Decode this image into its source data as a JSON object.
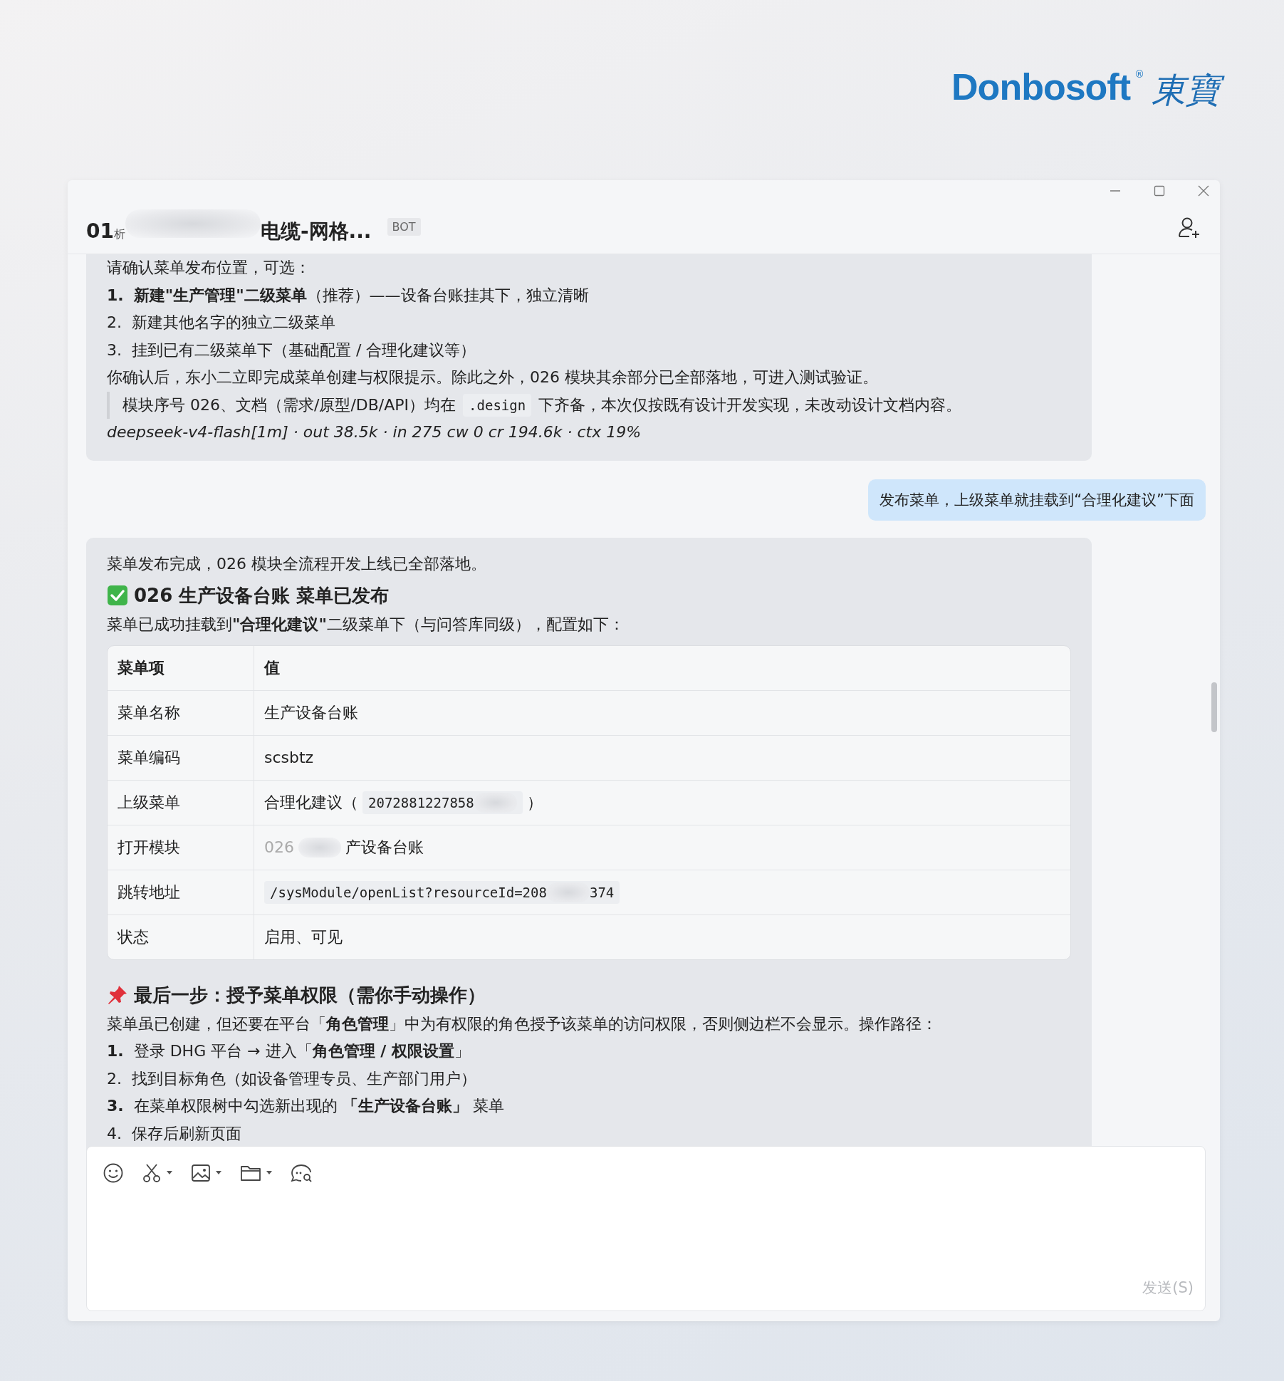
{
  "logo": {
    "text": "Donbosoft",
    "registered": "®",
    "chinese": "東寶"
  },
  "window": {
    "title": [
      {
        "kind": "text",
        "text": "01"
      },
      {
        "kind": "small",
        "text": "析"
      },
      {
        "kind": "blur"
      },
      {
        "kind": "text",
        "text": "电缆-网格..."
      }
    ],
    "badge": "BOT"
  },
  "messages": [
    {
      "kind": "bot",
      "blocks": [
        {
          "kind": "p",
          "text": "请确认菜单发布位置，可选："
        },
        {
          "kind": "li",
          "number": "1.",
          "number_bold": true,
          "text": "**新建\"生产管理\"二级菜单**（推荐）——设备台账挂其下，独立清晰"
        },
        {
          "kind": "li",
          "number": "2.",
          "number_bold": false,
          "text": "新建其他名字的独立二级菜单"
        },
        {
          "kind": "li",
          "number": "3.",
          "number_bold": false,
          "text": "挂到已有二级菜单下（基础配置 / 合理化建议等）"
        },
        {
          "kind": "p",
          "text": "你确认后，东小二立即完成菜单创建与权限提示。除此之外，026 模块其余部分已全部落地，可进入测试验证。"
        },
        {
          "kind": "quote",
          "parts": [
            {
              "kind": "text",
              "text": "模块序号 026、文档（需求/原型/DB/API）均在"
            },
            {
              "kind": "code",
              "text": ".design"
            },
            {
              "kind": "text",
              "text": "下齐备，本次仅按既有设计开发实现，未改动设计文档内容。"
            }
          ]
        },
        {
          "kind": "meta",
          "text": "deepseek-v4-flash[1m] · out 38.5k · in 275 cw 0 cr 194.6k · ctx 19%"
        }
      ]
    },
    {
      "kind": "user",
      "text": "发布菜单，上级菜单就挂载到“合理化建议”下面"
    },
    {
      "kind": "bot",
      "blocks": [
        {
          "kind": "p",
          "text": "菜单发布完成，026 模块全流程开发上线已全部落地。"
        },
        {
          "kind": "checkheading",
          "text": "026 生产设备台账 菜单已发布"
        },
        {
          "kind": "p",
          "text": "菜单已成功挂载到**\"合理化建议\"**二级菜单下（与问答库同级），配置如下："
        },
        {
          "kind": "table",
          "columns": [
            "菜单项",
            "值"
          ],
          "rows": [
            {
              "label": "菜单名称",
              "value": [
                {
                  "kind": "text",
                  "text": "生产设备台账"
                }
              ]
            },
            {
              "label": "菜单编码",
              "value": [
                {
                  "kind": "text",
                  "text": "scsbtz"
                }
              ]
            },
            {
              "label": "上级菜单",
              "value": [
                {
                  "kind": "text",
                  "text": "合理化建议（"
                },
                {
                  "kind": "code",
                  "parts": [
                    {
                      "kind": "text",
                      "text": "2072881227858"
                    },
                    {
                      "kind": "blur"
                    }
                  ]
                },
                {
                  "kind": "text",
                  "text": "）"
                }
              ]
            },
            {
              "label": "打开模块",
              "value": [
                {
                  "kind": "faint",
                  "text": "026"
                },
                {
                  "kind": "blur"
                },
                {
                  "kind": "text",
                  "text": "产设备台账"
                }
              ]
            },
            {
              "label": "跳转地址",
              "value": [
                {
                  "kind": "code",
                  "parts": [
                    {
                      "kind": "text",
                      "text": "/sysModule/openList?resourceId=208"
                    },
                    {
                      "kind": "blur"
                    },
                    {
                      "kind": "text",
                      "text": "374"
                    }
                  ]
                }
              ]
            },
            {
              "label": "状态",
              "value": [
                {
                  "kind": "text",
                  "text": "启用、可见"
                }
              ]
            }
          ]
        },
        {
          "kind": "pinheading",
          "text": "最后一步：授予菜单权限（需你手动操作）"
        },
        {
          "kind": "p",
          "text": "菜单虽已创建，但还要在平台「**角色管理**」中为有权限的角色授予该菜单的访问权限，否则侧边栏不会显示。操作路径："
        },
        {
          "kind": "li",
          "number": "1.",
          "number_bold": true,
          "text": "登录 DHG 平台 → 进入「**角色管理 / 权限设置**」"
        },
        {
          "kind": "li",
          "number": "2.",
          "number_bold": false,
          "text": "找到目标角色（如设备管理专员、生产部门用户）"
        },
        {
          "kind": "li",
          "number": "3.",
          "number_bold": true,
          "text": "在菜单权限树中勾选新出现的 **「生产设备台账」** 菜单"
        },
        {
          "kind": "li",
          "number": "4.",
          "number_bold": false,
          "text": "保存后刷新页面"
        }
      ]
    }
  ],
  "composer": {
    "tools": [
      {
        "kind": "emoji",
        "menu": false
      },
      {
        "kind": "scissors",
        "menu": true
      },
      {
        "kind": "image",
        "menu": true
      },
      {
        "kind": "folder",
        "menu": true
      },
      {
        "kind": "chat-search",
        "menu": false
      }
    ],
    "send": "发送(S)"
  }
}
